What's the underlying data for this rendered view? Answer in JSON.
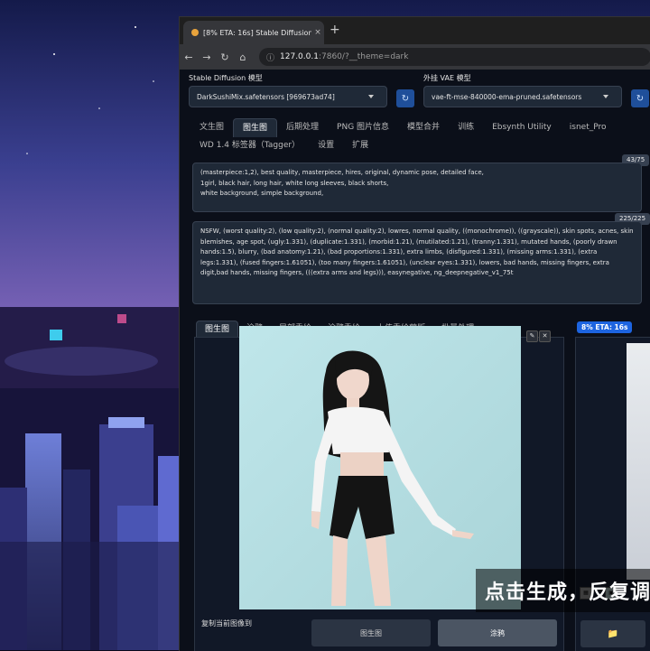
{
  "browser": {
    "tab_title": "[8% ETA: 16s] Stable Diffusion",
    "tab_close": "×",
    "new_tab": "+",
    "url_host": "127.0.0.1",
    "url_path": ":7860/?__theme=dark",
    "nav_icons": [
      "back-icon",
      "forward-icon",
      "reload-icon",
      "home-icon"
    ]
  },
  "models": {
    "sd_label": "Stable Diffusion 模型",
    "sd_value": "DarkSushiMix.safetensors [969673ad74]",
    "vae_label": "外挂 VAE 模型",
    "vae_value": "vae-ft-mse-840000-ema-pruned.safetensors"
  },
  "main_tabs": {
    "row1": [
      "文生图",
      "图生图",
      "后期处理",
      "PNG 图片信息",
      "模型合并",
      "训练",
      "Ebsynth Utility",
      "isnet_Pro"
    ],
    "row2": [
      "WD 1.4 标签器（Tagger）",
      "设置",
      "扩展"
    ],
    "active": "图生图"
  },
  "prompt": {
    "positive": "(masterpiece:1,2), best quality, masterpiece, hires, original, dynamic pose, detailed face,\n1girl, black hair, long hair, white long sleeves, black shorts,\nwhite background, simple background,",
    "positive_count": "43/75",
    "negative": "NSFW, (worst quality:2), (low quality:2), (normal quality:2), lowres, normal quality, ((monochrome)), ((grayscale)), skin spots, acnes, skin blemishes, age spot, (ugly:1.331), (duplicate:1.331), (morbid:1.21), (mutilated:1.21), (tranny:1.331), mutated hands, (poorly drawn hands:1.5), blurry, (bad anatomy:1.21), (bad proportions:1.331), extra limbs, (disfigured:1.331), (missing arms:1.331), (extra legs:1.331), (fused fingers:1.61051), (too many fingers:1.61051), (unclear eyes:1.331), lowers, bad hands, missing fingers, extra digit,bad hands, missing fingers, (((extra arms and legs))), easynegative, ng_deepnegative_v1_75t",
    "negative_count": "225/225"
  },
  "sub_tabs": {
    "items": [
      "图生图",
      "涂鸦",
      "局部重绘",
      "涂鸦重绘",
      "上传重绘蒙版",
      "批量处理"
    ],
    "active": "图生图"
  },
  "image_panel": {
    "copy_label": "复制当前图像到",
    "btn_img2img": "图生图",
    "btn_sketch": "涂鸦",
    "close_glyph": "✕",
    "edit_glyph": "✎"
  },
  "output": {
    "progress_text": "8% ETA: 16s",
    "progress_fraction": 0.08,
    "folder_icon": "folder-icon"
  },
  "subtitle": "点击生成，反复调",
  "colors": {
    "accent": "#1d64e0",
    "background": "#0b0f19"
  }
}
